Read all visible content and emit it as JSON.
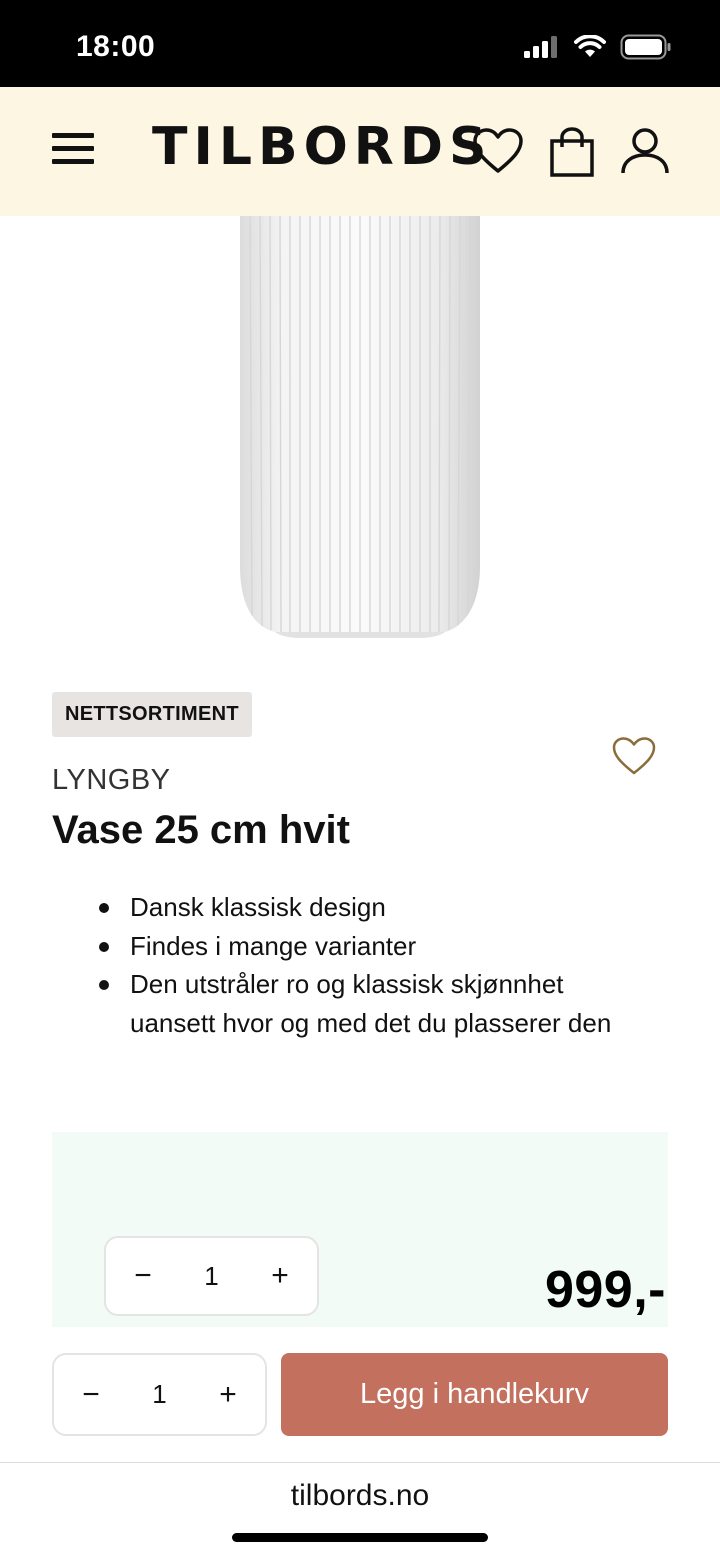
{
  "status_bar": {
    "time": "18:00"
  },
  "header": {
    "logo": "TILBORDS",
    "menu_icon": "hamburger-icon",
    "wishlist_icon": "heart-icon",
    "cart_icon": "shopping-bag-icon",
    "account_icon": "user-icon",
    "background": "#fdf6e3"
  },
  "product": {
    "image_subject": "white fluted vase",
    "badge": "NETTSORTIMENT",
    "brand": "LYNGBY",
    "title": "Vase 25 cm hvit",
    "features": [
      "Dansk klassisk design",
      "Findes i mange varianter",
      "Den utstråler ro og klassisk skjønnhet uansett hvor og med det du plasserer den"
    ],
    "price": "999,-"
  },
  "purchase_panel": {
    "quantity": "1",
    "minus": "−",
    "plus": "+",
    "panel_color": "#f2fbf6"
  },
  "sticky_bar": {
    "quantity": "1",
    "minus": "−",
    "plus": "+",
    "add_to_cart_label": "Legg i handlekurv",
    "button_color": "#c4705e"
  },
  "browser": {
    "url": "tilbords.no"
  }
}
